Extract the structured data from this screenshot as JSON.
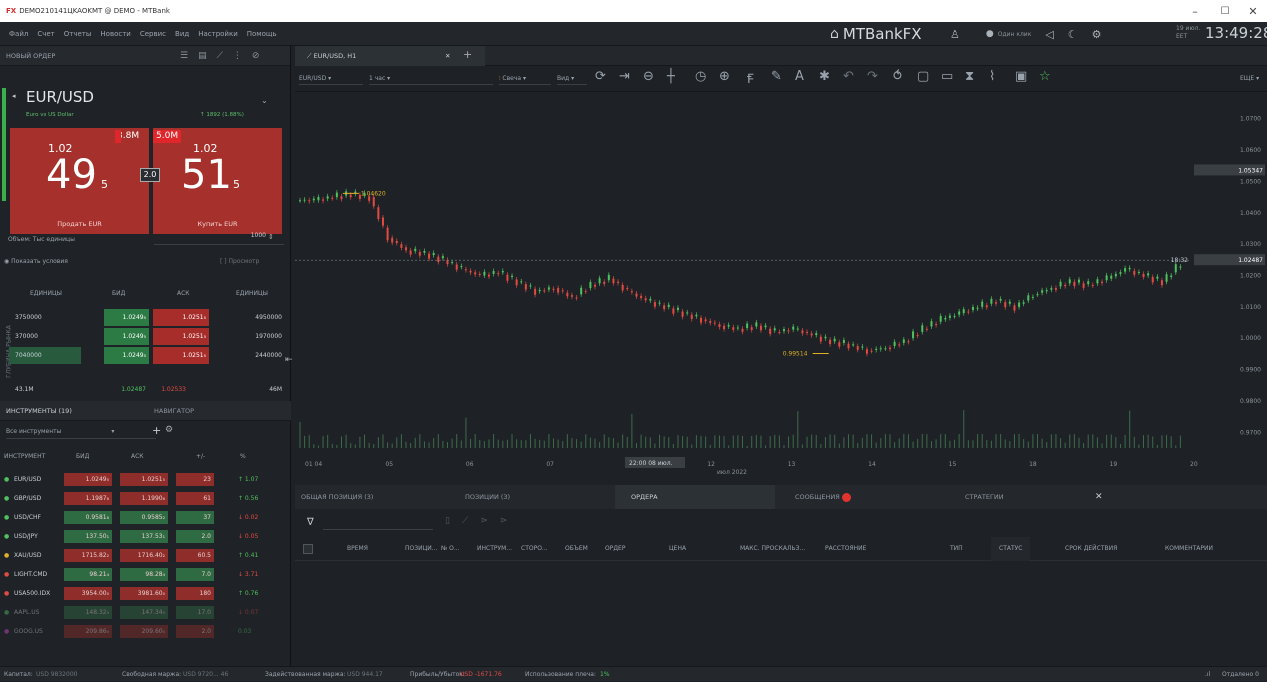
{
  "window": {
    "title": "DEMO210141ЦKAOKMT @ DEMO - MTBank",
    "logo": "FX",
    "min": "–",
    "max": "☐",
    "close": "✕"
  },
  "menu": [
    "Файл",
    "Счет",
    "Отчеты",
    "Новости",
    "Сервис",
    "Вид",
    "Настройки",
    "Помощь"
  ],
  "brand": "MTBankFX",
  "clock": {
    "time": "13:49:28",
    "date_line1": "19 июл.",
    "date_line2": "EET"
  },
  "top_toggle_label": "Один клик",
  "order_panel": {
    "header": "НОВЫЙ ОРДЕР",
    "symbol": "EUR/USD",
    "symbol_desc": "Euro vs US Dollar",
    "change": "↑ 1892 (1.88%)",
    "sell": {
      "vol": "3.8M",
      "small": "1.02",
      "big": "49",
      "suffix": "5",
      "label": "Продать EUR"
    },
    "buy": {
      "vol": "5.0M",
      "small": "1.02",
      "big": "51",
      "suffix": "5",
      "label": "Купить EUR"
    },
    "spread": "2.0",
    "volume_label": "Объем: Тыс единицы",
    "volume_value": "1000",
    "show_conditions": "Показать условия",
    "preview": "Просмотр"
  },
  "depth": {
    "side_label": "ГЛУБИНА РЫНКА",
    "headers": [
      "ЕДИНИЦЫ",
      "БИД",
      "АСК",
      "ЕДИНИЦЫ"
    ],
    "rows": [
      {
        "u1": "3750000",
        "bid": "1.0249₅",
        "ask": "1.0251₅",
        "u2": "4950000"
      },
      {
        "u1": "370000",
        "bid": "1.0249₅",
        "ask": "1.0251₅",
        "u2": "1970000"
      },
      {
        "u1": "7040000",
        "bid": "1.0249₅",
        "ask": "1.0251₅",
        "u2": "2440000"
      }
    ],
    "total_left": "43.1M",
    "total_mid_bid": "1.02487",
    "total_mid_ask": "1.02533",
    "total_right": "46M"
  },
  "instr_tabs": {
    "tab1": "ИНСТРУМЕНТЫ (19)",
    "tab2": "НАВИГАТОР"
  },
  "instr_filter": "Все инструменты",
  "instr_headers": [
    "ИНСТРУМЕНТ",
    "БИД",
    "АСК",
    "+/-",
    "%"
  ],
  "instruments": [
    {
      "name": "EUR/USD",
      "bid": "1.0249₅",
      "ask": "1.0251₅",
      "chg": "23",
      "pct": "↑ 1.07",
      "up": true
    },
    {
      "name": "GBP/USD",
      "bid": "1.1987₆",
      "ask": "1.1990₆",
      "chg": "61",
      "pct": "↑ 0.56",
      "up": true
    },
    {
      "name": "USD/CHF",
      "bid": "0.9581₆",
      "ask": "0.9585₂",
      "chg": "37",
      "pct": "↓ 0.02",
      "up": false
    },
    {
      "name": "USD/JPY",
      "bid": "137.50₁",
      "ask": "137.53₁",
      "chg": "2.0",
      "pct": "↓ 0.05",
      "up": false
    },
    {
      "name": "XAU/USD",
      "bid": "1715.82₂",
      "ask": "1716.40₂",
      "chg": "60.5",
      "pct": "↑ 0.41",
      "up": true
    },
    {
      "name": "LIGHT.CMD",
      "bid": "98.21₄",
      "ask": "98.28₄",
      "chg": "7.0",
      "pct": "↓ 3.71",
      "up": false
    },
    {
      "name": "USA500.IDX",
      "bid": "3954.00₀",
      "ask": "3981.60₀",
      "chg": "180",
      "pct": "↑ 0.76",
      "up": true
    },
    {
      "name": "AAPL.US",
      "bid": "148.32₅",
      "ask": "147.34₅",
      "chg": "17.0",
      "pct": "↓ 0.07",
      "up": false
    },
    {
      "name": "GOOG.US",
      "bid": "209.86₀",
      "ask": "209.60₀",
      "chg": "2.0",
      "pct": "0.03",
      "up": true
    }
  ],
  "chart_tab": "EUR/USD, H1",
  "chart_toolbar": {
    "symbol": "EUR/USD",
    "period": "1 час",
    "type": "Свеча",
    "view": "Вид",
    "more": "ЕЩЕ"
  },
  "chart_data": {
    "type": "line",
    "y_ticks": [
      "1.0700",
      "1.0600",
      "1.0500",
      "1.0400",
      "1.0300",
      "1.0200",
      "1.0100",
      "1.0000",
      "0.9900",
      "0.9800",
      "0.9700"
    ],
    "x_ticks": [
      "01 04",
      "05",
      "06",
      "07",
      "08",
      "12",
      "13",
      "14",
      "15",
      "18",
      "19",
      "20"
    ],
    "x_center_label": "22:00 08 июл.",
    "x_sub_label": "июл 2022",
    "hi_label": "1.04620",
    "lo_label": "0.99514",
    "price_tag": "1.02487",
    "price_tag2": "1.05347",
    "tag_small": "18:32",
    "close": [
      1.044,
      1.045,
      1.046,
      1.045,
      1.032,
      1.028,
      1.027,
      1.025,
      1.022,
      1.02,
      1.021,
      1.018,
      1.015,
      1.016,
      1.013,
      1.017,
      1.019,
      1.015,
      1.012,
      1.01,
      1.008,
      1.006,
      1.004,
      1.003,
      1.004,
      1.002,
      1.003,
      1.001,
      0.999,
      0.998,
      0.996,
      0.997,
      0.999,
      1.003,
      1.006,
      1.008,
      1.01,
      1.012,
      1.01,
      1.014,
      1.016,
      1.018,
      1.017,
      1.019,
      1.022,
      1.02,
      1.018,
      1.024
    ]
  },
  "bottom_tabs": [
    "ОБЩАЯ ПОЗИЦИЯ (3)",
    "ПОЗИЦИИ (3)",
    "ОРДЕРА",
    "СООБЩЕНИЯ",
    "СТРАТЕГИИ"
  ],
  "orders_columns": [
    "ВРЕМЯ",
    "ПОЗИЦИ...",
    "№ О...",
    "ИНСТРУМ...",
    "СТОРО...",
    "ОБЪЕМ",
    "ОРДЕР",
    "ЦЕНА",
    "МАКС. ПРОСКАЛЬЗ...",
    "РАССТОЯНИЕ",
    "ТИП",
    "СТАТУС",
    "СРОК ДЕЙСТВИЯ",
    "КОММЕНТАРИИ"
  ],
  "status": {
    "capital": "Капитал:",
    "capital_val": "USD 9832000",
    "free": "Свободная маржа:",
    "free_val": "USD 9720... 46",
    "used": "Задействованная маржа:",
    "used_val": "USD 944.17",
    "pl": "Прибыль/Убыток:",
    "pl_val": "USD -1671.76",
    "lev": "Использование плеча:",
    "lev_val": "1%",
    "conn": "Отдалено 0"
  }
}
